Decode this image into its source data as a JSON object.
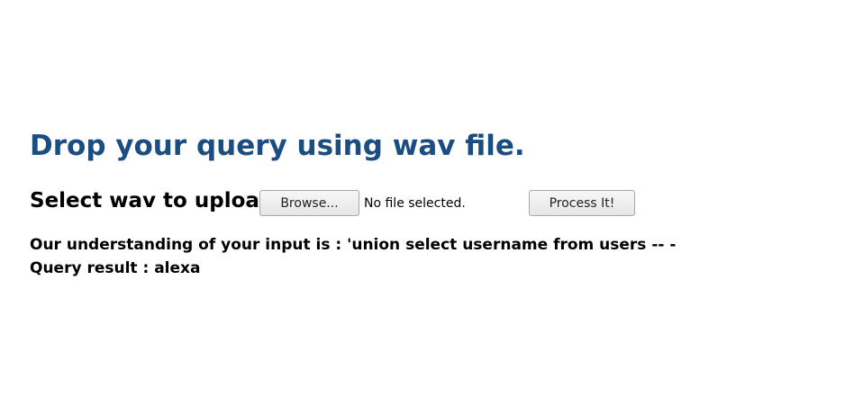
{
  "header": {
    "title": "Drop your query using wav file."
  },
  "upload": {
    "label": "Select wav to upload:",
    "browse_label": "Browse...",
    "file_status": "No file selected.",
    "submit_label": "Process It!"
  },
  "results": {
    "understanding": "Our understanding of your input is : 'union select username from users -- -",
    "query_result": "Query result : alexa"
  },
  "colors": {
    "title": "#1b4c82",
    "text": "#000000",
    "background": "#ffffff"
  }
}
